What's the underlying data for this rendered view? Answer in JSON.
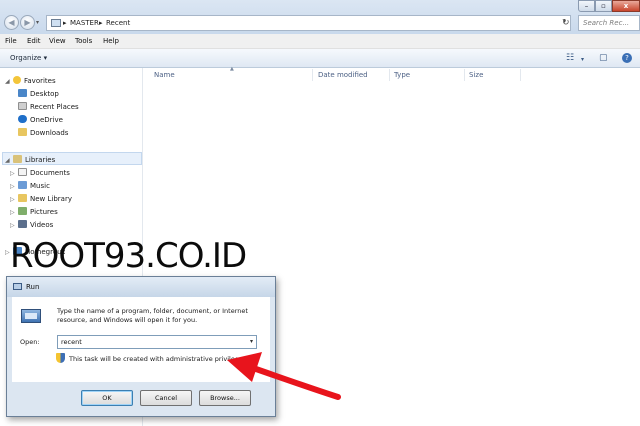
{
  "window": {
    "controls": {
      "minimize": "–",
      "maximize": "▫",
      "close": "x"
    }
  },
  "nav": {
    "back": "◀",
    "forward": "▶",
    "dropdown": "▾"
  },
  "address": {
    "segments": [
      "MASTER",
      "Recent"
    ],
    "separator": "▸",
    "dropdown": "▾",
    "refresh": "↻"
  },
  "search": {
    "placeholder": "Search Rec..."
  },
  "menu": {
    "items": [
      "File",
      "Edit",
      "View",
      "Tools",
      "Help"
    ]
  },
  "toolbar": {
    "organize": "Organize ▾",
    "views_icon": "☷",
    "views_dd": "▾",
    "preview_icon": "▢",
    "help_icon": "?"
  },
  "sidebar": {
    "favorites": {
      "label": "Favorites",
      "items": [
        "Desktop",
        "Recent Places",
        "OneDrive",
        "Downloads"
      ]
    },
    "libraries": {
      "label": "Libraries",
      "items": [
        "Documents",
        "Music",
        "New Library",
        "Pictures",
        "Videos"
      ]
    },
    "partial_item": "Homegroup"
  },
  "columns": {
    "name": "Name",
    "date_modified": "Date modified",
    "type": "Type",
    "size": "Size",
    "sort_indicator": "▲"
  },
  "watermark": "ROOT93.CO.ID",
  "run_dialog": {
    "title": "Run",
    "description": "Type the name of a program, folder, document, or Internet resource, and Windows will open it for you.",
    "open_label": "Open:",
    "open_value": "recent",
    "open_dropdown": "▾",
    "note": "This task will be created with administrative privileges.",
    "buttons": {
      "ok": "OK",
      "cancel": "Cancel",
      "browse": "Browse..."
    }
  },
  "colors": {
    "annotation_arrow": "#e8141c",
    "selection": "#e7f0fb"
  }
}
